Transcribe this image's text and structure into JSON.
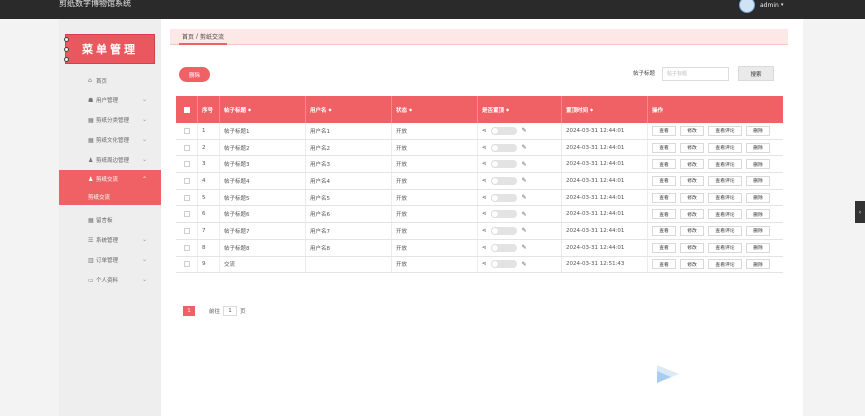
{
  "app": {
    "title": "剪纸数字博物馆系统",
    "user": "admin"
  },
  "sidebar": {
    "banner": "菜单管理",
    "items": [
      {
        "label": "首页",
        "icon": "home-icon",
        "has_children": false
      },
      {
        "label": "用户管理",
        "icon": "user-group-icon",
        "has_children": true
      },
      {
        "label": "剪纸分类管理",
        "icon": "grid-icon",
        "has_children": true
      },
      {
        "label": "剪纸文化管理",
        "icon": "grid-icon",
        "has_children": true
      },
      {
        "label": "剪纸周边管理",
        "icon": "person-icon",
        "has_children": true
      },
      {
        "label": "剪纸交流",
        "icon": "person-icon",
        "has_children": true,
        "active": true,
        "children": [
          "剪纸交流"
        ]
      },
      {
        "label": "留言板",
        "icon": "grid-icon",
        "has_children": false
      },
      {
        "label": "系统管理",
        "icon": "list-icon",
        "has_children": true
      },
      {
        "label": "订单管理",
        "icon": "bar-chart-icon",
        "has_children": true
      },
      {
        "label": "个人资料",
        "icon": "profile-icon",
        "has_children": true
      }
    ]
  },
  "breadcrumb": {
    "home": "首页",
    "separator": "/",
    "current": "剪纸交流"
  },
  "toolbar": {
    "delete_label": "删除",
    "search_label": "帖子标题",
    "search_placeholder": "帖子标题",
    "search_button": "搜索"
  },
  "table": {
    "columns": [
      "序号",
      "帖子标题",
      "用户名",
      "状态",
      "是否置顶",
      "置顶时间",
      "操作"
    ],
    "rows": [
      {
        "idx": "1",
        "title": "帖子标题1",
        "user": "用户名1",
        "status": "开放",
        "time": "2024-03-31 12:44:01"
      },
      {
        "idx": "2",
        "title": "帖子标题2",
        "user": "用户名2",
        "status": "开放",
        "time": "2024-03-31 12:44:01"
      },
      {
        "idx": "3",
        "title": "帖子标题3",
        "user": "用户名3",
        "status": "开放",
        "time": "2024-03-31 12:44:01"
      },
      {
        "idx": "4",
        "title": "帖子标题4",
        "user": "用户名4",
        "status": "开放",
        "time": "2024-03-31 12:44:01"
      },
      {
        "idx": "5",
        "title": "帖子标题5",
        "user": "用户名5",
        "status": "开放",
        "time": "2024-03-31 12:44:01"
      },
      {
        "idx": "6",
        "title": "帖子标题6",
        "user": "用户名6",
        "status": "开放",
        "time": "2024-03-31 12:44:01"
      },
      {
        "idx": "7",
        "title": "帖子标题7",
        "user": "用户名7",
        "status": "开放",
        "time": "2024-03-31 12:44:01"
      },
      {
        "idx": "8",
        "title": "帖子标题8",
        "user": "用户名8",
        "status": "开放",
        "time": "2024-03-31 12:44:01"
      },
      {
        "idx": "9",
        "title": "交流",
        "user": "",
        "status": "开放",
        "time": "2024-03-31 12:51:43"
      }
    ],
    "ops": {
      "view": "查看",
      "edit": "修改",
      "comments": "查看评论",
      "delete": "删除"
    }
  },
  "pagination": {
    "current_page": "1",
    "goto_label": "前往",
    "goto_value": "1",
    "page_suffix": "页"
  },
  "colors": {
    "accent": "#f06166",
    "topbar": "#2a2a2a"
  }
}
